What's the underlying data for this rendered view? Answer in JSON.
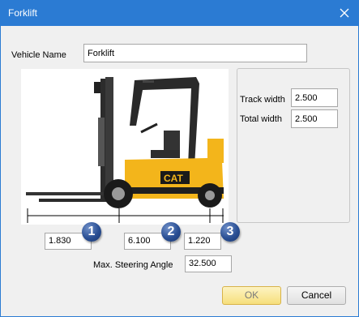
{
  "window": {
    "title": "Forklift",
    "close_icon": "close-icon"
  },
  "form": {
    "vehicle_name_label": "Vehicle Name",
    "vehicle_name_value": "Forklift"
  },
  "track": {
    "track_width_label": "Track width",
    "track_width_value": "2.500",
    "total_width_label": "Total width",
    "total_width_value": "2.500"
  },
  "dimensions": {
    "d1_value": "1.830",
    "d2_value": "6.100",
    "d3_value": "1.220",
    "badge1": "1",
    "badge2": "2",
    "badge3": "3"
  },
  "steering": {
    "label": "Max. Steering Angle",
    "value": "32.500"
  },
  "buttons": {
    "ok": "OK",
    "cancel": "Cancel"
  },
  "image": {
    "brand_text": "CAT",
    "icon": "forklift-image"
  },
  "colors": {
    "titlebar": "#2b7bd3",
    "forklift_body": "#f3b51b",
    "badge": "#2a4f94"
  }
}
